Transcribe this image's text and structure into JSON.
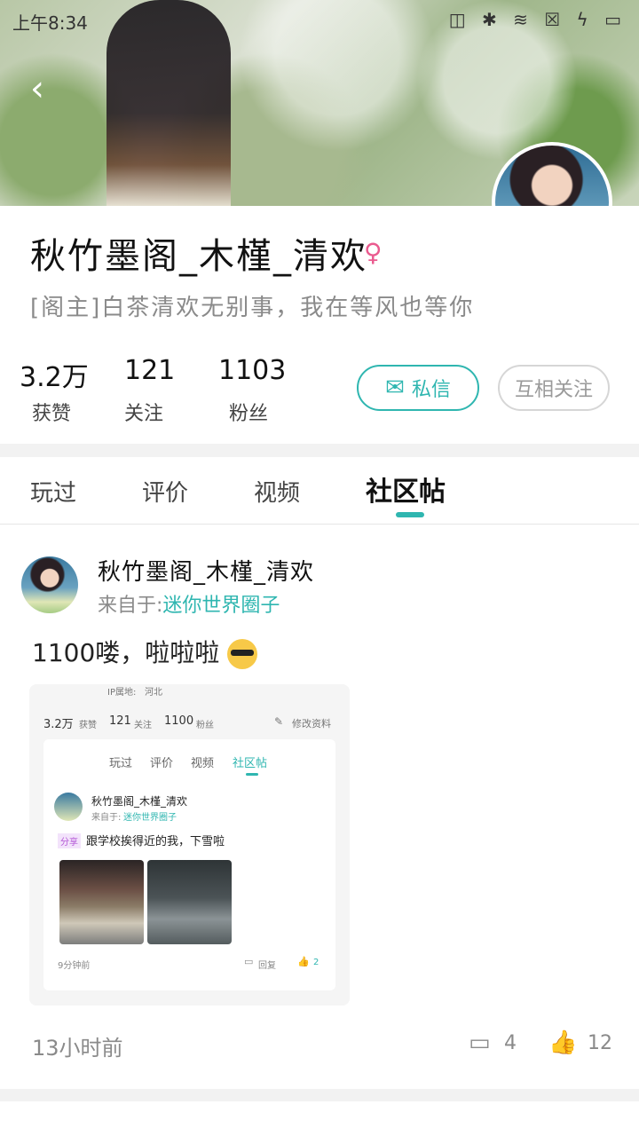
{
  "status_bar": {
    "time": "上午8:34",
    "icons_text": "◫ ✱ ≋ ☒ ϟ ▭"
  },
  "profile": {
    "name": "秋竹墨阁_木槿_清欢",
    "gender_icon": "♀",
    "signature": "[阁主]白茶清欢无别事，我在等风也等你",
    "stats": [
      {
        "value": "3.2万",
        "label": "获赞"
      },
      {
        "value": "121",
        "label": "关注"
      },
      {
        "value": "1103",
        "label": "粉丝"
      }
    ],
    "message_button": "私信",
    "follow_button": "互相关注"
  },
  "tabs": [
    "玩过",
    "评价",
    "视频",
    "社区帖"
  ],
  "post": {
    "author": "秋竹墨阁_木槿_清欢",
    "from_prefix": "来自于:",
    "from_link": "迷你世界圈子",
    "text": "1100喽，啦啦啦",
    "time": "13小时前",
    "comments": "4",
    "likes": "12",
    "embedded": {
      "ip_label": "IP属地:",
      "ip_value": "河北",
      "stats": [
        {
          "value": "3.2万",
          "label": "获赞"
        },
        {
          "value": "121",
          "label": "关注"
        },
        {
          "value": "1100",
          "label": "粉丝"
        }
      ],
      "edit_label": "修改资料",
      "tabs": [
        "玩过",
        "评价",
        "视频",
        "社区帖"
      ],
      "author": "秋竹墨阁_木槿_清欢",
      "from_prefix": "来自于:",
      "from_link": "迷你世界圈子",
      "tag": "分享",
      "text": "跟学校挨得近的我，下雪啦",
      "time": "9分钟前",
      "reply_label": "回复",
      "likes": "2"
    }
  },
  "colors": {
    "accent": "#2fb6b0",
    "gender": "#ea5b8f",
    "muted": "#8a8a8a"
  }
}
